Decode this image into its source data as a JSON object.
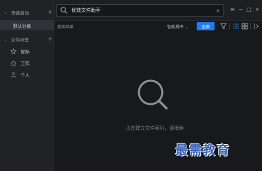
{
  "sidebar": {
    "quick_start": {
      "label": "快捷启动",
      "add": "+"
    },
    "default_category": "默认分组",
    "file_tags": {
      "label": "文件标签",
      "add": "+"
    },
    "tags": [
      {
        "label": "星标",
        "icon": "star-icon"
      },
      {
        "label": "工作",
        "icon": "home-icon"
      },
      {
        "label": "个人",
        "icon": "person-icon"
      }
    ]
  },
  "search": {
    "value": "优效文件助手",
    "clear": "×"
  },
  "window_controls": {
    "menu": "≡",
    "minimize": "−",
    "maximize": "□",
    "close": "×"
  },
  "toolbar": {
    "results_label": "搜索结果",
    "sort_label": "智能排序 ⌄",
    "all_button": "全部"
  },
  "empty_state": {
    "message": "正在建立文件索引，请稍候"
  },
  "watermark": "最需教育",
  "colors": {
    "accent": "#1d7cf2",
    "background": "#17191c",
    "sidebar": "#202226"
  }
}
